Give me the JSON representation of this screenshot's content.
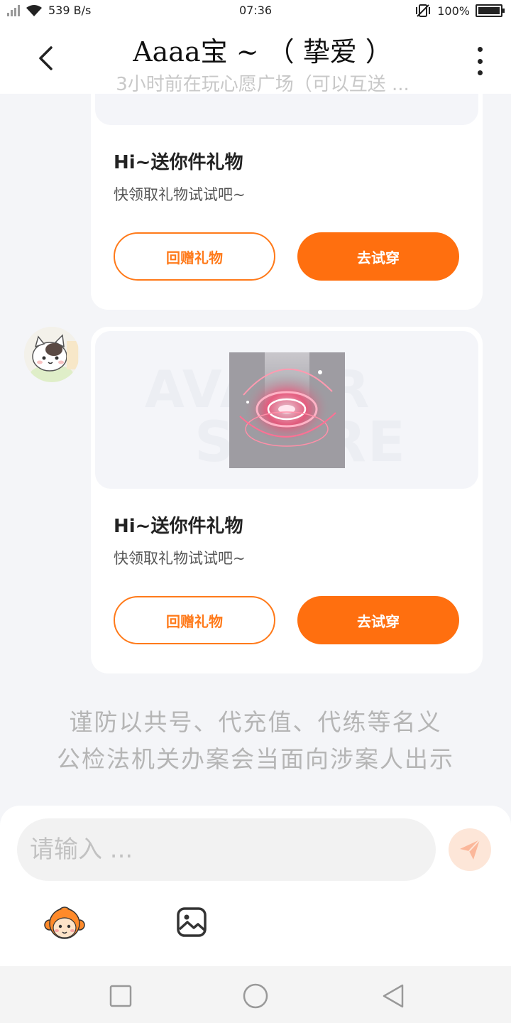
{
  "status": {
    "net_speed": "539 B/s",
    "time": "07:36",
    "battery": "100%"
  },
  "header": {
    "title": "Aaaa宝 ~ （ 挚爱 ）",
    "subtitle": "3小时前在玩心愿广场（可以互送 ..."
  },
  "gifts": [
    {
      "heading": "Hi~送你件礼物",
      "desc": "快领取礼物试试吧~",
      "return_gift": "回赠礼物",
      "try_on": "去试穿"
    },
    {
      "heading": "Hi~送你件礼物",
      "desc": "快领取礼物试试吧~",
      "return_gift": "回赠礼物",
      "try_on": "去试穿",
      "watermark_line1": "AVATAR",
      "watermark_line2": "STORE"
    }
  ],
  "notice": {
    "line1": "谨防以共号、代充值、代练等名义",
    "line2": "公检法机关办案会当面向涉案人出示"
  },
  "composer": {
    "placeholder": "请输入 ..."
  },
  "colors": {
    "accent": "#ff6f0f",
    "send_bg": "#fde6d8"
  }
}
